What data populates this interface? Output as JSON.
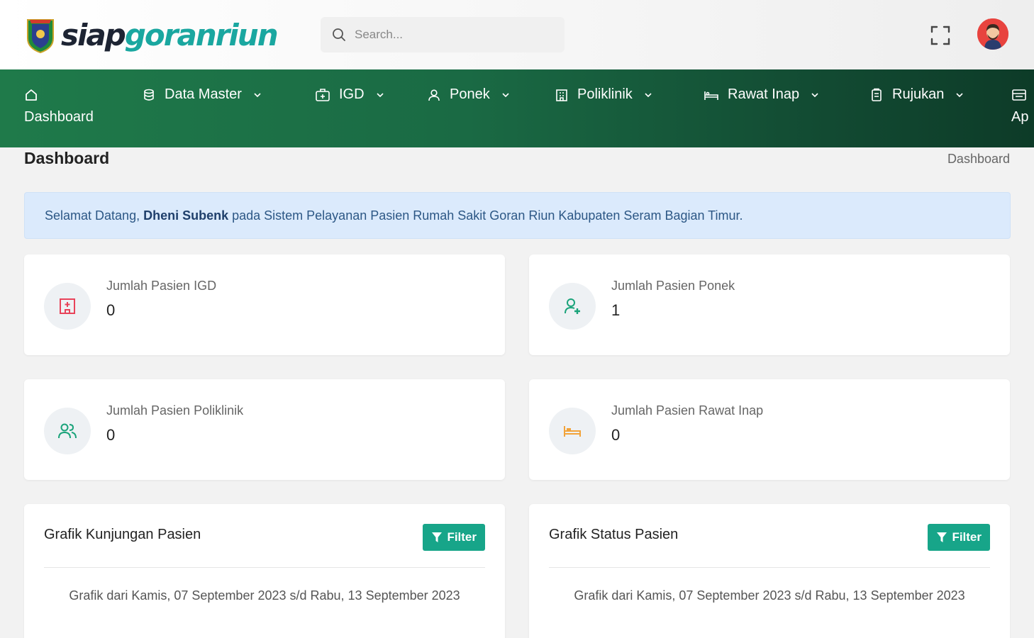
{
  "app": {
    "logo_part1": "siap",
    "logo_part2": "goranriun"
  },
  "search": {
    "placeholder": "Search..."
  },
  "nav": {
    "items": [
      {
        "label": "Dashboard",
        "icon": "home-icon"
      },
      {
        "label": "Data Master",
        "icon": "database-icon"
      },
      {
        "label": "IGD",
        "icon": "first-aid-icon"
      },
      {
        "label": "Ponek",
        "icon": "user-icon"
      },
      {
        "label": "Poliklinik",
        "icon": "building-icon"
      },
      {
        "label": "Rawat Inap",
        "icon": "bed-icon"
      },
      {
        "label": "Rujukan",
        "icon": "clipboard-icon"
      },
      {
        "label": "Ap",
        "icon": "register-icon"
      }
    ]
  },
  "page": {
    "title": "Dashboard",
    "breadcrumb": "Dashboard"
  },
  "alert": {
    "prefix": "Selamat Datang, ",
    "user": "Dheni Subenk",
    "suffix": " pada Sistem Pelayanan Pasien Rumah Sakit Goran Riun Kabupaten Seram Bagian Timur."
  },
  "stats": [
    {
      "label": "Jumlah Pasien IGD",
      "value": "0",
      "icon": "hospital-icon",
      "color": "#e8435a"
    },
    {
      "label": "Jumlah Pasien Ponek",
      "value": "1",
      "icon": "user-plus-icon",
      "color": "#1aa37a"
    },
    {
      "label": "Jumlah Pasien Poliklinik",
      "value": "0",
      "icon": "users-icon",
      "color": "#1aa37a"
    },
    {
      "label": "Jumlah Pasien Rawat Inap",
      "value": "0",
      "icon": "bed-icon",
      "color": "#f2a33a"
    }
  ],
  "charts": [
    {
      "title": "Grafik Kunjungan Pasien",
      "filter_label": "Filter",
      "subtitle": "Grafik dari Kamis, 07 September 2023 s/d Rabu, 13 September 2023"
    },
    {
      "title": "Grafik Status Pasien",
      "filter_label": "Filter",
      "subtitle": "Grafik dari Kamis, 07 September 2023 s/d Rabu, 13 September 2023"
    }
  ],
  "colors": {
    "nav_start": "#1f7a4a",
    "nav_end": "#0d3b28",
    "accent": "#17a589",
    "alert_bg": "#dbeafc"
  }
}
